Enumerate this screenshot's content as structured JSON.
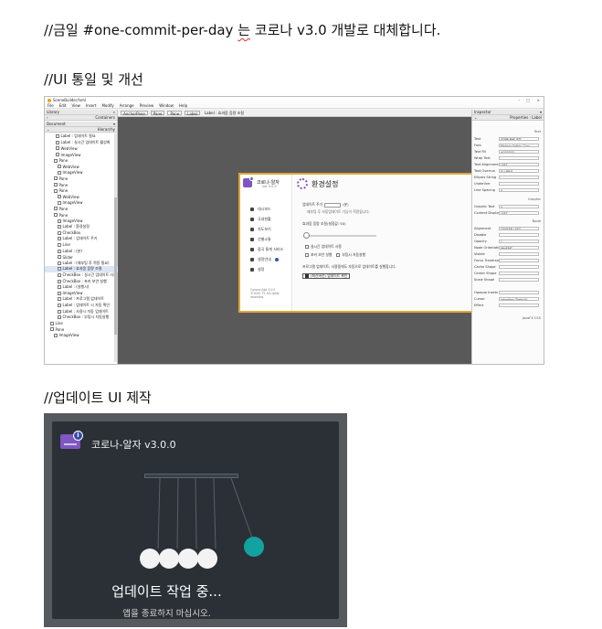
{
  "headings": {
    "line1_prefix": "//금일 #one-commit-per-day ",
    "line1_marked": "는",
    "line1_suffix": " 코로나 v3.0 개발로 대체합니다.",
    "section1": "//UI 통일 및 개선",
    "section2": "//업데이트 UI 제작"
  },
  "scene_builder": {
    "window_title": "SceneBuilder.fxml",
    "menu": [
      "File",
      "Edit",
      "View",
      "Insert",
      "Modify",
      "Arrange",
      "Preview",
      "Window",
      "Help"
    ],
    "library_label": "Library",
    "components_label": "Containers",
    "document_label": "Document",
    "hierarchy_label": "Hierarchy",
    "hierarchy_items": [
      "Label : 업데이트 필요",
      "Label : 실시간 업데이트 활성화",
      "WebView",
      "ImageView",
      "Pane",
      "WebView",
      "ImageView",
      "Pane",
      "Pane",
      "Pane",
      "WebView",
      "ImageView",
      "Pane",
      "Pane",
      "ImageView",
      "Label : 환경설정",
      "CheckBox",
      "Label : 업데이트 주기",
      "Line",
      "Label : (분)",
      "Slider",
      "Label : (재부팅 후 적용 필요)",
      "Label : 효과음 음량 조절",
      "CheckBox : 실시간 업데이트 사용",
      "CheckBox : 포커 보안 실행",
      "Label : (실행시)",
      "ImageView",
      "Label : 프로그램 업데이트",
      "Label : 업데이트 시 자동 확인",
      "Label : 사용시 자동 업데이트",
      "CheckBox : 부팅시 자동실행",
      "Line",
      "Pane",
      "ImageView"
    ],
    "breadcrumbs": [
      "AnchorPane",
      "Pane",
      "Pane",
      "Label",
      "Label : 효과음 음량 조절"
    ],
    "inspector_label": "Inspector",
    "properties_label": "Properties : Label",
    "app": {
      "name": "코로나-알자",
      "version": "ver 3.0.0",
      "side_items": [
        "대시보드",
        "국내현황",
        "지도보기",
        "선별소통",
        "중국 통계 서비스",
        "설정안내",
        "설정"
      ],
      "footer_line1": "Corona-Alja 3.0.0",
      "footer_line2": "©2020 TY. All rights reserved.",
      "title": "환경설정",
      "update_cycle": "업데이트 주기",
      "minutes_unit": "(분)",
      "restart_note": "재부팅 후 자동업데이트 기능이 적용됩니다.",
      "volume_label": "효과음 음량 조절(설정값: 50)",
      "realtime_update": "실시간 업데이트 사용",
      "focus_security": "포커 보안 실행",
      "boot_autorun": "부팅시 자동실행",
      "program_update_note": "프로그램 업데이트: 사용중에도 자동으로 업데이트를 실행합니다.",
      "check_button": "(최신버전) 업데이트 확인"
    },
    "inspector_rows": [
      {
        "label": "Text",
        "value": "효과음 음량 조절"
      },
      {
        "label": "Font",
        "value": "Malgun Gothic 11px"
      },
      {
        "label": "Text Fill",
        "value": "#333333"
      },
      {
        "label": "Wrap Text",
        "value": ""
      },
      {
        "label": "Text Alignment",
        "value": "LEFT"
      },
      {
        "label": "Text Overrun",
        "value": "ELLIPSIS"
      },
      {
        "label": "Ellipsis String",
        "value": "..."
      },
      {
        "label": "Underline",
        "value": ""
      },
      {
        "label": "Line Spacing",
        "value": "0"
      },
      {
        "label": "Graphic Text",
        "value": "4"
      },
      {
        "label": "Content Display",
        "value": "LEFT"
      },
      {
        "label": "Alignment",
        "value": "CENTER_LEFT"
      },
      {
        "label": "Disable",
        "value": ""
      },
      {
        "label": "Opacity",
        "value": "1"
      },
      {
        "label": "Node Orientation",
        "value": "INHERIT"
      },
      {
        "label": "Visible",
        "value": ""
      },
      {
        "label": "Focus Traversable",
        "value": ""
      },
      {
        "label": "Cache Shape",
        "value": ""
      },
      {
        "label": "Center Shape",
        "value": ""
      },
      {
        "label": "Scale Shape",
        "value": ""
      },
      {
        "label": "Opaque Insets",
        "value": ""
      },
      {
        "label": "Cursor",
        "value": "Inherited (Default)"
      },
      {
        "label": "Effect",
        "value": ""
      }
    ],
    "inspector_sections": [
      "Text",
      "Graphic",
      "Node",
      "JavaFX CSS"
    ]
  },
  "update_window": {
    "title": "코로나-알자 v3.0.0",
    "status": "업데이트 작업 중...",
    "subtitle": "앱을 종료하지 마십시오.",
    "info_icon": "i",
    "accent_color": "#12a3a0",
    "ball_color": "#f3f3f3",
    "logo_color": "#7e57c2"
  }
}
